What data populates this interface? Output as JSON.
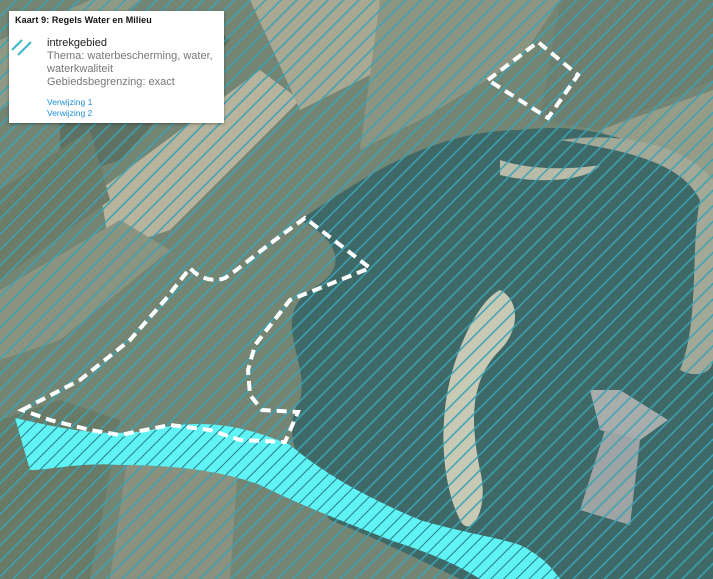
{
  "legend": {
    "title": "Kaart 9: Regels Water en Milieu",
    "item": {
      "name": "intrekgebied",
      "theme": "Thema: waterbescherming, water, waterkwaliteit",
      "boundary": "Gebiedsbegrenzing: exact",
      "swatch_icon": "diagonal-hatch-icon",
      "color": "#3fb6c8"
    },
    "links": [
      "Verwijzing 1",
      "Verwijzing 2"
    ]
  },
  "map": {
    "hatch_color": "#3aa3b4",
    "highlight_color": "#5ff3f6",
    "boundary_color": "#ffffff",
    "lake_color": "#3f6967",
    "land_color": "#6d7f73"
  }
}
